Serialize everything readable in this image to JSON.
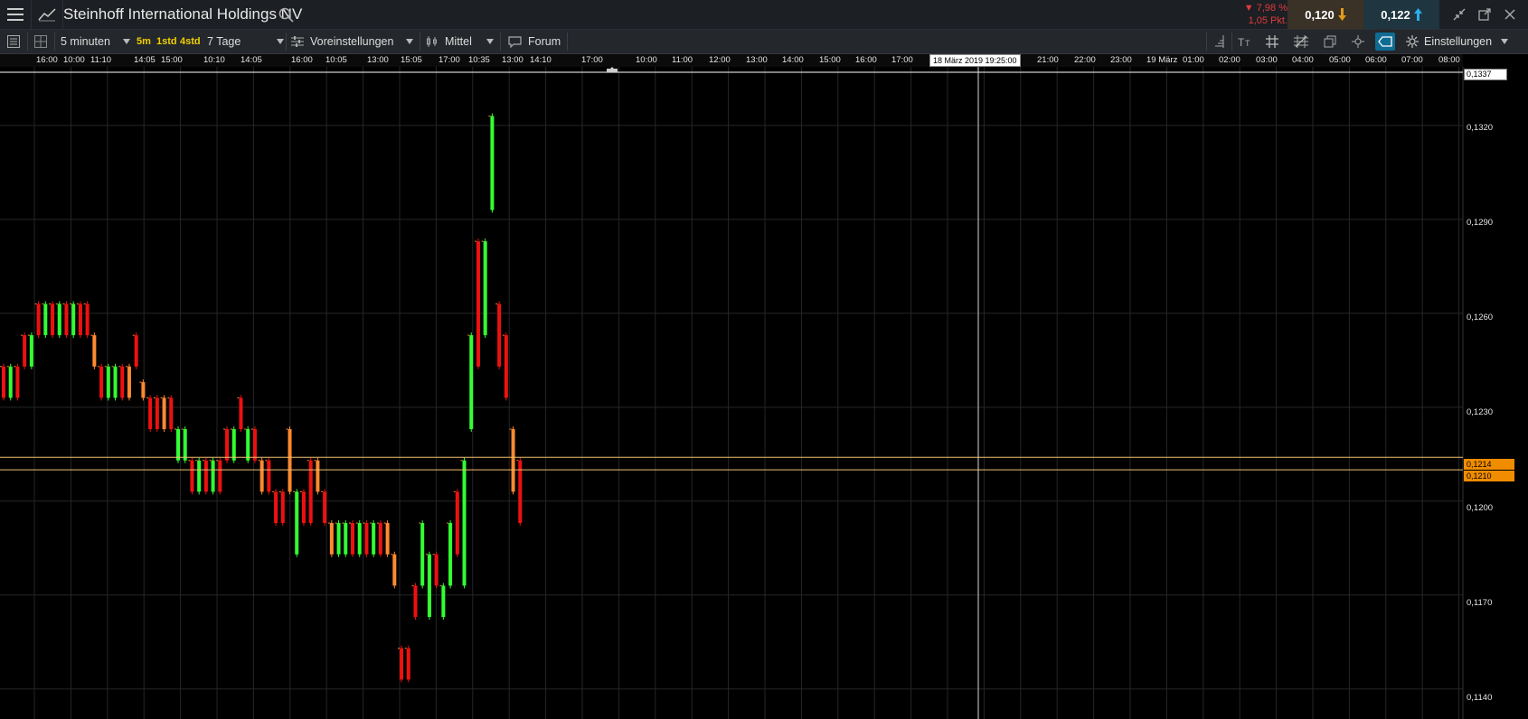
{
  "header": {
    "title": "Steinhoff International Holdings NV",
    "change_pct": "▼ 7,98 %",
    "change_pts": "1,05 Pkt.",
    "bid": "0,120",
    "ask": "0,122"
  },
  "toolbar": {
    "interval": "5 minuten",
    "btn_5m": "5m",
    "btn_1std": "1std",
    "btn_4std": "4std",
    "range": "7 Tage",
    "presets": "Voreinstellungen",
    "indicator": "Mittel",
    "forum": "Forum",
    "settings": "Einstellungen"
  },
  "time_axis": {
    "ticks": [
      "16:00",
      "10:00",
      "11:10",
      "14:05",
      "15:00",
      "10:10",
      "14:05",
      "16:00",
      "10:05",
      "13:00",
      "15:05",
      "17:00",
      "10:35",
      "13:00",
      "14:10",
      "17:00",
      "10:00",
      "11:00",
      "12:00",
      "13:00",
      "14:00",
      "15:00",
      "16:00",
      "17:00",
      "21:00",
      "22:00",
      "23:00",
      "19 März",
      "01:00",
      "02:00",
      "03:00",
      "04:00",
      "05:00",
      "06:00",
      "07:00",
      "08:00"
    ],
    "crosshair_label": "18 März 2019 19:25:00"
  },
  "price_axis": {
    "ticks": [
      "0,1320",
      "0,1290",
      "0,1260",
      "0,1230",
      "0,1200",
      "0,1170",
      "0,1140"
    ],
    "top_label": "0,1337",
    "marker_upper": "0,1214",
    "marker_lower": "0,1210"
  },
  "colors": {
    "up": "#33ff33",
    "down": "#ee1111",
    "flat": "#ff8a30",
    "accent": "#0f6c94",
    "marker": "#f08c00"
  },
  "chart_data": {
    "type": "candlestick",
    "yrange": [
      0.1133,
      0.1337
    ],
    "candles": [
      [
        0.1233,
        0.1243,
        "d"
      ],
      [
        0.1233,
        0.1243,
        "u"
      ],
      [
        0.1233,
        0.1243,
        "d"
      ],
      [
        0.1243,
        0.1253,
        "d"
      ],
      [
        0.1243,
        0.1253,
        "u"
      ],
      [
        0.1253,
        0.1263,
        "d"
      ],
      [
        0.1253,
        0.1263,
        "u"
      ],
      [
        0.1253,
        0.1263,
        "d"
      ],
      [
        0.1253,
        0.1263,
        "u"
      ],
      [
        0.1253,
        0.1263,
        "d"
      ],
      [
        0.1253,
        0.1263,
        "u"
      ],
      [
        0.1253,
        0.1263,
        "d"
      ],
      [
        0.1253,
        0.1263,
        "d"
      ],
      [
        0.1243,
        0.1253,
        "f"
      ],
      [
        0.1233,
        0.1243,
        "d"
      ],
      [
        0.1233,
        0.1243,
        "u"
      ],
      [
        0.1233,
        0.1243,
        "u"
      ],
      [
        0.1233,
        0.1243,
        "d"
      ],
      [
        0.1233,
        0.1243,
        "f"
      ],
      [
        0.1243,
        0.1253,
        "d"
      ],
      [
        0.1233,
        0.1238,
        "f"
      ],
      [
        0.1223,
        0.1233,
        "d"
      ],
      [
        0.1223,
        0.1233,
        "d"
      ],
      [
        0.1223,
        0.1233,
        "f"
      ],
      [
        0.1223,
        0.1233,
        "d"
      ],
      [
        0.1213,
        0.1223,
        "u"
      ],
      [
        0.1213,
        0.1223,
        "u"
      ],
      [
        0.1203,
        0.1213,
        "d"
      ],
      [
        0.1203,
        0.1213,
        "u"
      ],
      [
        0.1203,
        0.1213,
        "d"
      ],
      [
        0.1203,
        0.1213,
        "u"
      ],
      [
        0.1203,
        0.1213,
        "d"
      ],
      [
        0.1213,
        0.1223,
        "d"
      ],
      [
        0.1213,
        0.1223,
        "u"
      ],
      [
        0.1223,
        0.1233,
        "d"
      ],
      [
        0.1213,
        0.1223,
        "u"
      ],
      [
        0.1213,
        0.1223,
        "d"
      ],
      [
        0.1203,
        0.1213,
        "f"
      ],
      [
        0.1203,
        0.1213,
        "d"
      ],
      [
        0.1193,
        0.1203,
        "d"
      ],
      [
        0.1193,
        0.1203,
        "d"
      ],
      [
        0.1203,
        0.1223,
        "f"
      ],
      [
        0.1183,
        0.1203,
        "u"
      ],
      [
        0.1193,
        0.1203,
        "d"
      ],
      [
        0.1193,
        0.1213,
        "d"
      ],
      [
        0.1203,
        0.1213,
        "f"
      ],
      [
        0.1193,
        0.1203,
        "d"
      ],
      [
        0.1183,
        0.1193,
        "f"
      ],
      [
        0.1183,
        0.1193,
        "u"
      ],
      [
        0.1183,
        0.1193,
        "u"
      ],
      [
        0.1183,
        0.1193,
        "d"
      ],
      [
        0.1183,
        0.1193,
        "u"
      ],
      [
        0.1183,
        0.1193,
        "d"
      ],
      [
        0.1183,
        0.1193,
        "u"
      ],
      [
        0.1183,
        0.1193,
        "d"
      ],
      [
        0.1183,
        0.1193,
        "f"
      ],
      [
        0.1173,
        0.1183,
        "f"
      ],
      [
        0.1143,
        0.1153,
        "d"
      ],
      [
        0.1143,
        0.1153,
        "d"
      ],
      [
        0.1163,
        0.1173,
        "d"
      ],
      [
        0.1173,
        0.1193,
        "u"
      ],
      [
        0.1163,
        0.1183,
        "u"
      ],
      [
        0.1173,
        0.1183,
        "d"
      ],
      [
        0.1163,
        0.1173,
        "u"
      ],
      [
        0.1173,
        0.1193,
        "u"
      ],
      [
        0.1183,
        0.1203,
        "d"
      ],
      [
        0.1173,
        0.1213,
        "u"
      ],
      [
        0.1223,
        0.1253,
        "u"
      ],
      [
        0.1243,
        0.1283,
        "d"
      ],
      [
        0.1253,
        0.1283,
        "u"
      ],
      [
        0.1293,
        0.1323,
        "u"
      ],
      [
        0.1243,
        0.1263,
        "d"
      ],
      [
        0.1233,
        0.1253,
        "d"
      ],
      [
        0.1203,
        0.1223,
        "f"
      ],
      [
        0.1193,
        0.1213,
        "d"
      ]
    ]
  }
}
